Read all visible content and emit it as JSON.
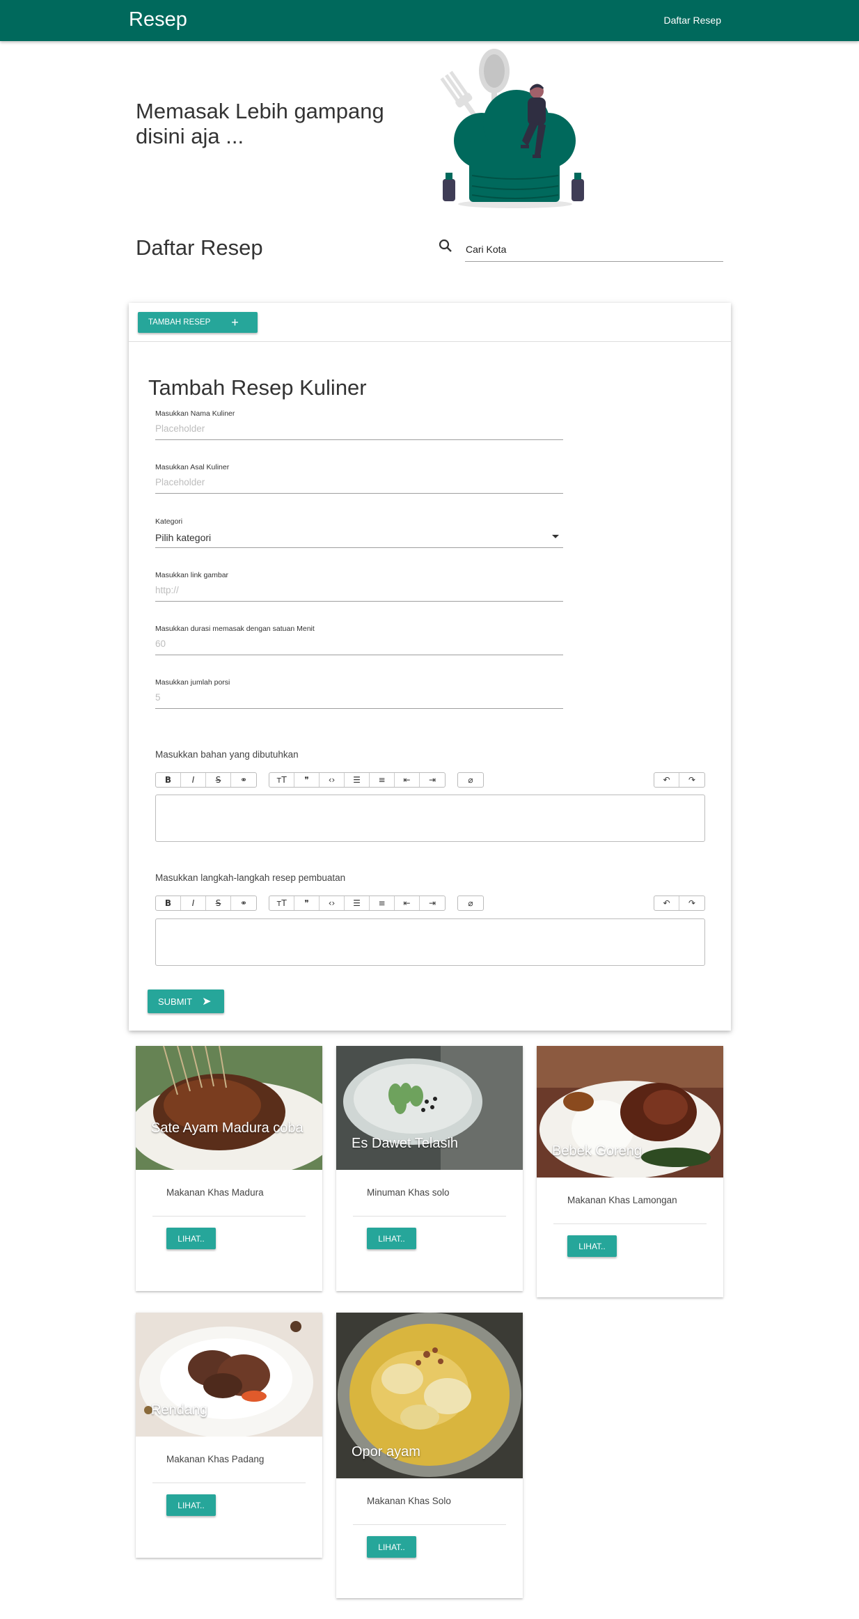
{
  "navbar": {
    "brand": "Resep",
    "link": "Daftar Resep"
  },
  "hero": {
    "title": "Memasak Lebih gampang disini aja ..."
  },
  "section": {
    "title": "Daftar Resep"
  },
  "search": {
    "placeholder": "Cari Kota",
    "icon": "search-icon"
  },
  "form": {
    "add_button": "TAMBAH RESEP",
    "title": "Tambah Resep Kuliner",
    "fields": {
      "name": {
        "label": "Masukkan Nama Kuliner",
        "placeholder": "Placeholder"
      },
      "origin": {
        "label": "Masukkan Asal Kuliner",
        "placeholder": "Placeholder"
      },
      "category": {
        "label": "Kategori",
        "value": "Pilih kategori"
      },
      "image": {
        "label": "Masukkan link gambar",
        "placeholder": "http://"
      },
      "duration": {
        "label": "Masukkan durasi memasak dengan satuan Menit",
        "placeholder": "60"
      },
      "portion": {
        "label": "Masukkan jumlah porsi",
        "placeholder": "5"
      }
    },
    "ingredients_label": "Masukkan bahan yang dibutuhkan",
    "steps_label": "Masukkan langkah-langkah resep pembuatan",
    "toolbar_icons": [
      "bold-icon",
      "italic-icon",
      "strikethrough-icon",
      "link-icon",
      "heading-icon",
      "quote-icon",
      "code-icon",
      "bullet-list-icon",
      "number-list-icon",
      "outdent-icon",
      "indent-icon",
      "attach-icon",
      "undo-icon",
      "redo-icon"
    ],
    "submit_label": "SUBMIT"
  },
  "recipes": [
    {
      "title": "Sate Ayam Madura coba",
      "desc": "Makanan Khas Madura",
      "button": "LIHAT.."
    },
    {
      "title": "Es Dawet Telasih",
      "desc": "Minuman Khas solo",
      "button": "LIHAT.."
    },
    {
      "title": "Bebek Goreng",
      "desc": "Makanan Khas Lamongan",
      "button": "LIHAT.."
    },
    {
      "title": "Rendang",
      "desc": "Makanan Khas Padang",
      "button": "LIHAT.."
    },
    {
      "title": "Opor ayam",
      "desc": "Makanan Khas Solo",
      "button": "LIHAT.."
    }
  ],
  "colors": {
    "navbar": "#00695c",
    "accent": "#26a69a"
  }
}
